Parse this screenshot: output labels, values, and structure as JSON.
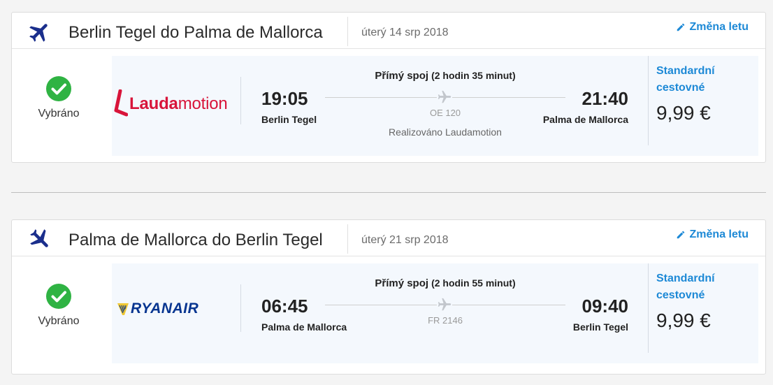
{
  "colors": {
    "accent": "#1d89d6",
    "success": "#2fb343",
    "plane_icon": "#1a2e8c",
    "laudamotion": "#d8143a",
    "ryanair": "#073590"
  },
  "flights": [
    {
      "route_title": "Berlin Tegel do Palma de Mallorca",
      "date": "úterý 14 srp 2018",
      "change_label": "Změna letu",
      "selected_label": "Vybráno",
      "airline_logo": {
        "part1": "Lauda",
        "part2": "motion"
      },
      "direct_label": "Přímý spoj",
      "duration": "(2 hodin 35 minut)",
      "departure_time": "19:05",
      "departure_place": "Berlin Tegel",
      "arrival_time": "21:40",
      "arrival_place": "Palma de Mallorca",
      "flight_number": "OE 120",
      "operated_by": "Realizováno Laudamotion",
      "fare_name": "Standardní cestovné",
      "price": "9,99 €"
    },
    {
      "route_title": "Palma de Mallorca do Berlin Tegel",
      "date": "úterý 21 srp 2018",
      "change_label": "Změna letu",
      "selected_label": "Vybráno",
      "airline_logo": {
        "text": "RYANAIR"
      },
      "direct_label": "Přímý spoj",
      "duration": "(2 hodin 55 minut)",
      "departure_time": "06:45",
      "departure_place": "Palma de Mallorca",
      "arrival_time": "09:40",
      "arrival_place": "Berlin Tegel",
      "flight_number": "FR 2146",
      "fare_name": "Standardní cestovné",
      "price": "9,99 €"
    }
  ]
}
